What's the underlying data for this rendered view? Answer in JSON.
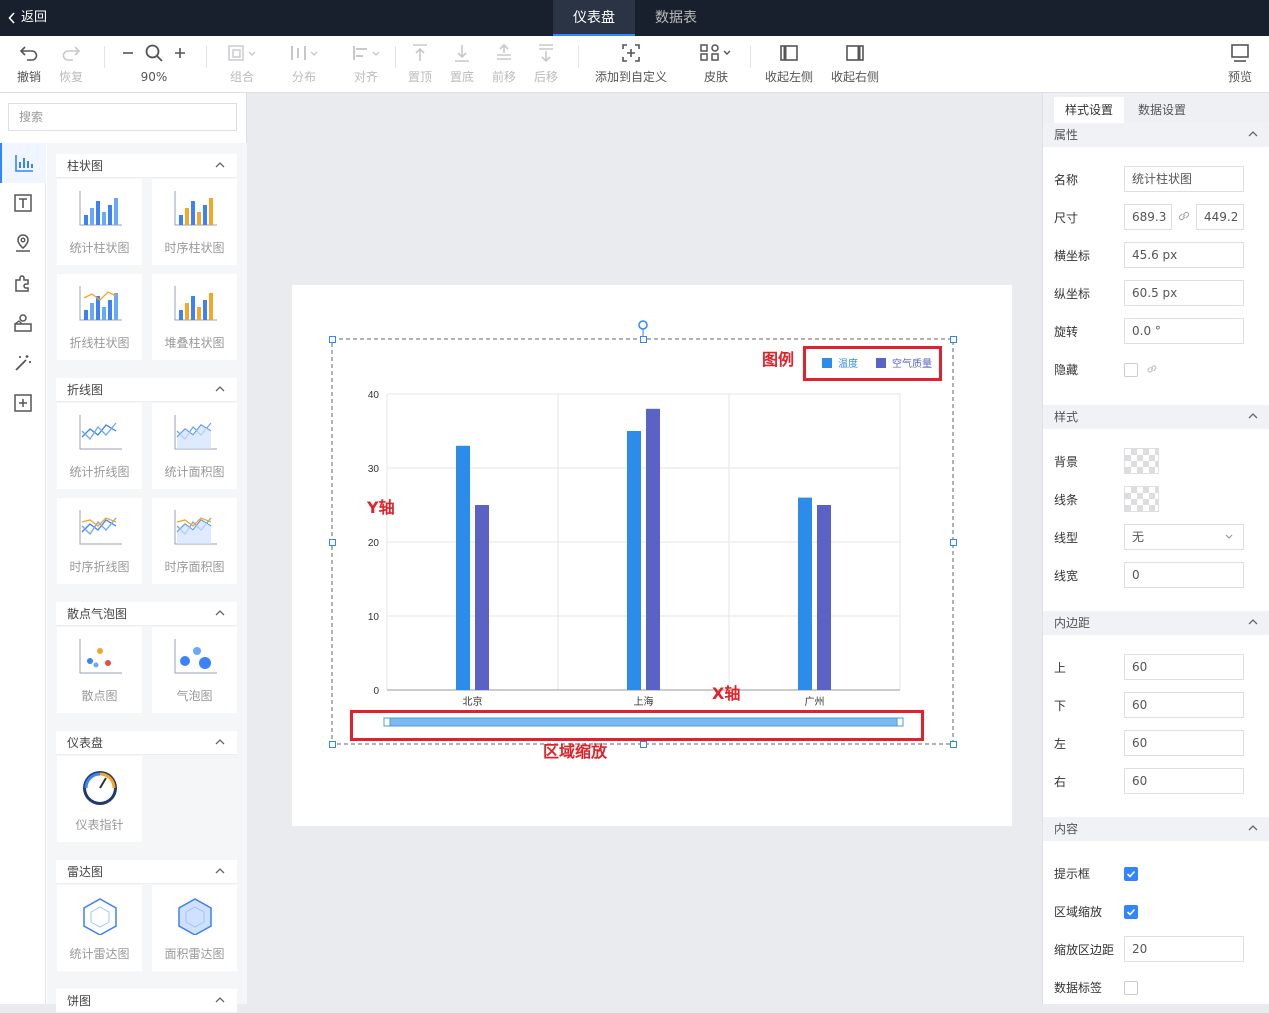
{
  "topbar": {
    "back_label": "返回",
    "tabs": [
      {
        "label": "仪表盘",
        "active": true
      },
      {
        "label": "数据表",
        "active": false
      }
    ]
  },
  "toolbar": {
    "undo": "撤销",
    "redo": "恢复",
    "zoom": "90%",
    "group": "组合",
    "distribute": "分布",
    "align": "对齐",
    "top": "置顶",
    "bottom": "置底",
    "forward": "前移",
    "backward": "后移",
    "add_custom": "添加到自定义",
    "skin": "皮肤",
    "collapse_left": "收起左侧",
    "collapse_right": "收起右侧",
    "preview": "预览"
  },
  "left": {
    "search_placeholder": "搜索",
    "side_icons": [
      "bar-chart-icon",
      "text-icon",
      "map-icon",
      "puzzle-icon",
      "shapes-icon",
      "magic-icon",
      "add-custom-icon"
    ],
    "categories": [
      {
        "title": "柱状图",
        "items": [
          "统计柱状图",
          "时序柱状图",
          "折线柱状图",
          "堆叠柱状图"
        ]
      },
      {
        "title": "折线图",
        "items": [
          "统计折线图",
          "统计面积图",
          "时序折线图",
          "时序面积图"
        ]
      },
      {
        "title": "散点气泡图",
        "items": [
          "散点图",
          "气泡图"
        ]
      },
      {
        "title": "仪表盘",
        "items": [
          "仪表指针"
        ]
      },
      {
        "title": "雷达图",
        "items": [
          "统计雷达图",
          "面积雷达图"
        ]
      },
      {
        "title": "饼图",
        "items": []
      }
    ]
  },
  "chart_data": {
    "type": "bar",
    "categories": [
      "北京",
      "上海",
      "广州"
    ],
    "series": [
      {
        "name": "温度",
        "values": [
          33,
          35,
          26
        ],
        "color": "#2b8de9"
      },
      {
        "name": "空气质量",
        "values": [
          25,
          38,
          25
        ],
        "color": "#5a62c6"
      }
    ],
    "ylim": [
      0,
      40
    ],
    "yticks": [
      0,
      10,
      20,
      30,
      40
    ],
    "grid": true,
    "legend": "top-right",
    "dataZoom": true
  },
  "annotations": {
    "legend": "图例",
    "yaxis": "Y轴",
    "xaxis": "X轴",
    "zoom": "区域缩放"
  },
  "right": {
    "tabs": [
      "样式设置",
      "数据设置"
    ],
    "sections": {
      "attr": "属性",
      "style": "样式",
      "padding": "内边距",
      "content": "内容"
    },
    "labels": {
      "name": "名称",
      "size": "尺寸",
      "x": "横坐标",
      "y": "纵坐标",
      "rotate": "旋转",
      "hidden": "隐藏",
      "bg": "背景",
      "line": "线条",
      "linetype": "线型",
      "linewidth": "线宽",
      "top": "上",
      "bottom": "下",
      "left": "左",
      "right": "右",
      "tooltip": "提示框",
      "zoom": "区域缩放",
      "zoom_margin": "缩放区边距",
      "data_label": "数据标签"
    },
    "values": {
      "name": "统计柱状图",
      "width": "689.3",
      "height": "449.2",
      "x": "45.6 px",
      "y": "60.5 px",
      "rotate": "0.0 °",
      "linetype": "无",
      "linewidth": "0",
      "pad_top": "60",
      "pad_bottom": "60",
      "pad_left": "60",
      "pad_right": "60",
      "zoom_margin": "20"
    },
    "checks": {
      "hidden": false,
      "tooltip": true,
      "zoom": true,
      "data_label": false
    }
  }
}
